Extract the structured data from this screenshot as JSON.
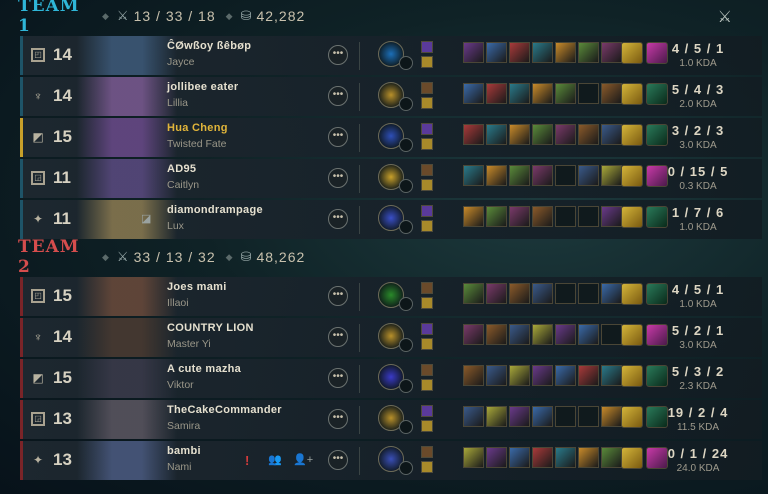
{
  "team1": {
    "name": "TEAM 1",
    "kda_summary": "13 / 33 / 18",
    "gold": "42,282"
  },
  "team2": {
    "name": "TEAM 2",
    "kda_summary": "33 / 13 / 32",
    "gold": "48,262"
  },
  "icons": {
    "swords": "crossed-swords-icon",
    "gold": "gold-coins-icon",
    "more": "more-options-icon"
  },
  "more_label": "•••",
  "colors": {
    "team1": "#2fb6d8",
    "team2": "#d54d4d",
    "highlight_player": "#e1b53a"
  },
  "players": [
    {
      "name": "ĈØwßoy ßêbøp",
      "champion": "Jayce",
      "level": "14",
      "kda": "4 / 5 / 1",
      "kda_ratio": "1.0 KDA",
      "role": "top"
    },
    {
      "name": "jollibee eater",
      "champion": "Lillia",
      "level": "14",
      "kda": "5 / 4 / 3",
      "kda_ratio": "2.0 KDA",
      "role": "jungle"
    },
    {
      "name": "Hua Cheng",
      "champion": "Twisted Fate",
      "level": "15",
      "kda": "3 / 2 / 3",
      "kda_ratio": "3.0 KDA",
      "role": "mid"
    },
    {
      "name": "AD95",
      "champion": "Caitlyn",
      "level": "11",
      "kda": "0 / 15 / 5",
      "kda_ratio": "0.3 KDA",
      "role": "bottom"
    },
    {
      "name": "diamondrampage",
      "champion": "Lux",
      "level": "11",
      "kda": "1 / 7 / 6",
      "kda_ratio": "1.0 KDA",
      "role": "support"
    },
    {
      "name": "Joes mami",
      "champion": "Illaoi",
      "level": "15",
      "kda": "4 / 5 / 1",
      "kda_ratio": "1.0 KDA",
      "role": "top"
    },
    {
      "name": "COUNTRY LION",
      "champion": "Master Yi",
      "level": "14",
      "kda": "5 / 2 / 1",
      "kda_ratio": "3.0 KDA",
      "role": "jungle"
    },
    {
      "name": "A cute mazha",
      "champion": "Viktor",
      "level": "15",
      "kda": "5 / 3 / 2",
      "kda_ratio": "2.3 KDA",
      "role": "mid"
    },
    {
      "name": "TheCakeCommander",
      "champion": "Samira",
      "level": "13",
      "kda": "19 / 2 / 4",
      "kda_ratio": "11.5 KDA",
      "role": "bottom"
    },
    {
      "name": "bambi",
      "champion": "Nami",
      "level": "13",
      "kda": "0 / 1 / 24",
      "kda_ratio": "24.0 KDA",
      "role": "support"
    }
  ]
}
